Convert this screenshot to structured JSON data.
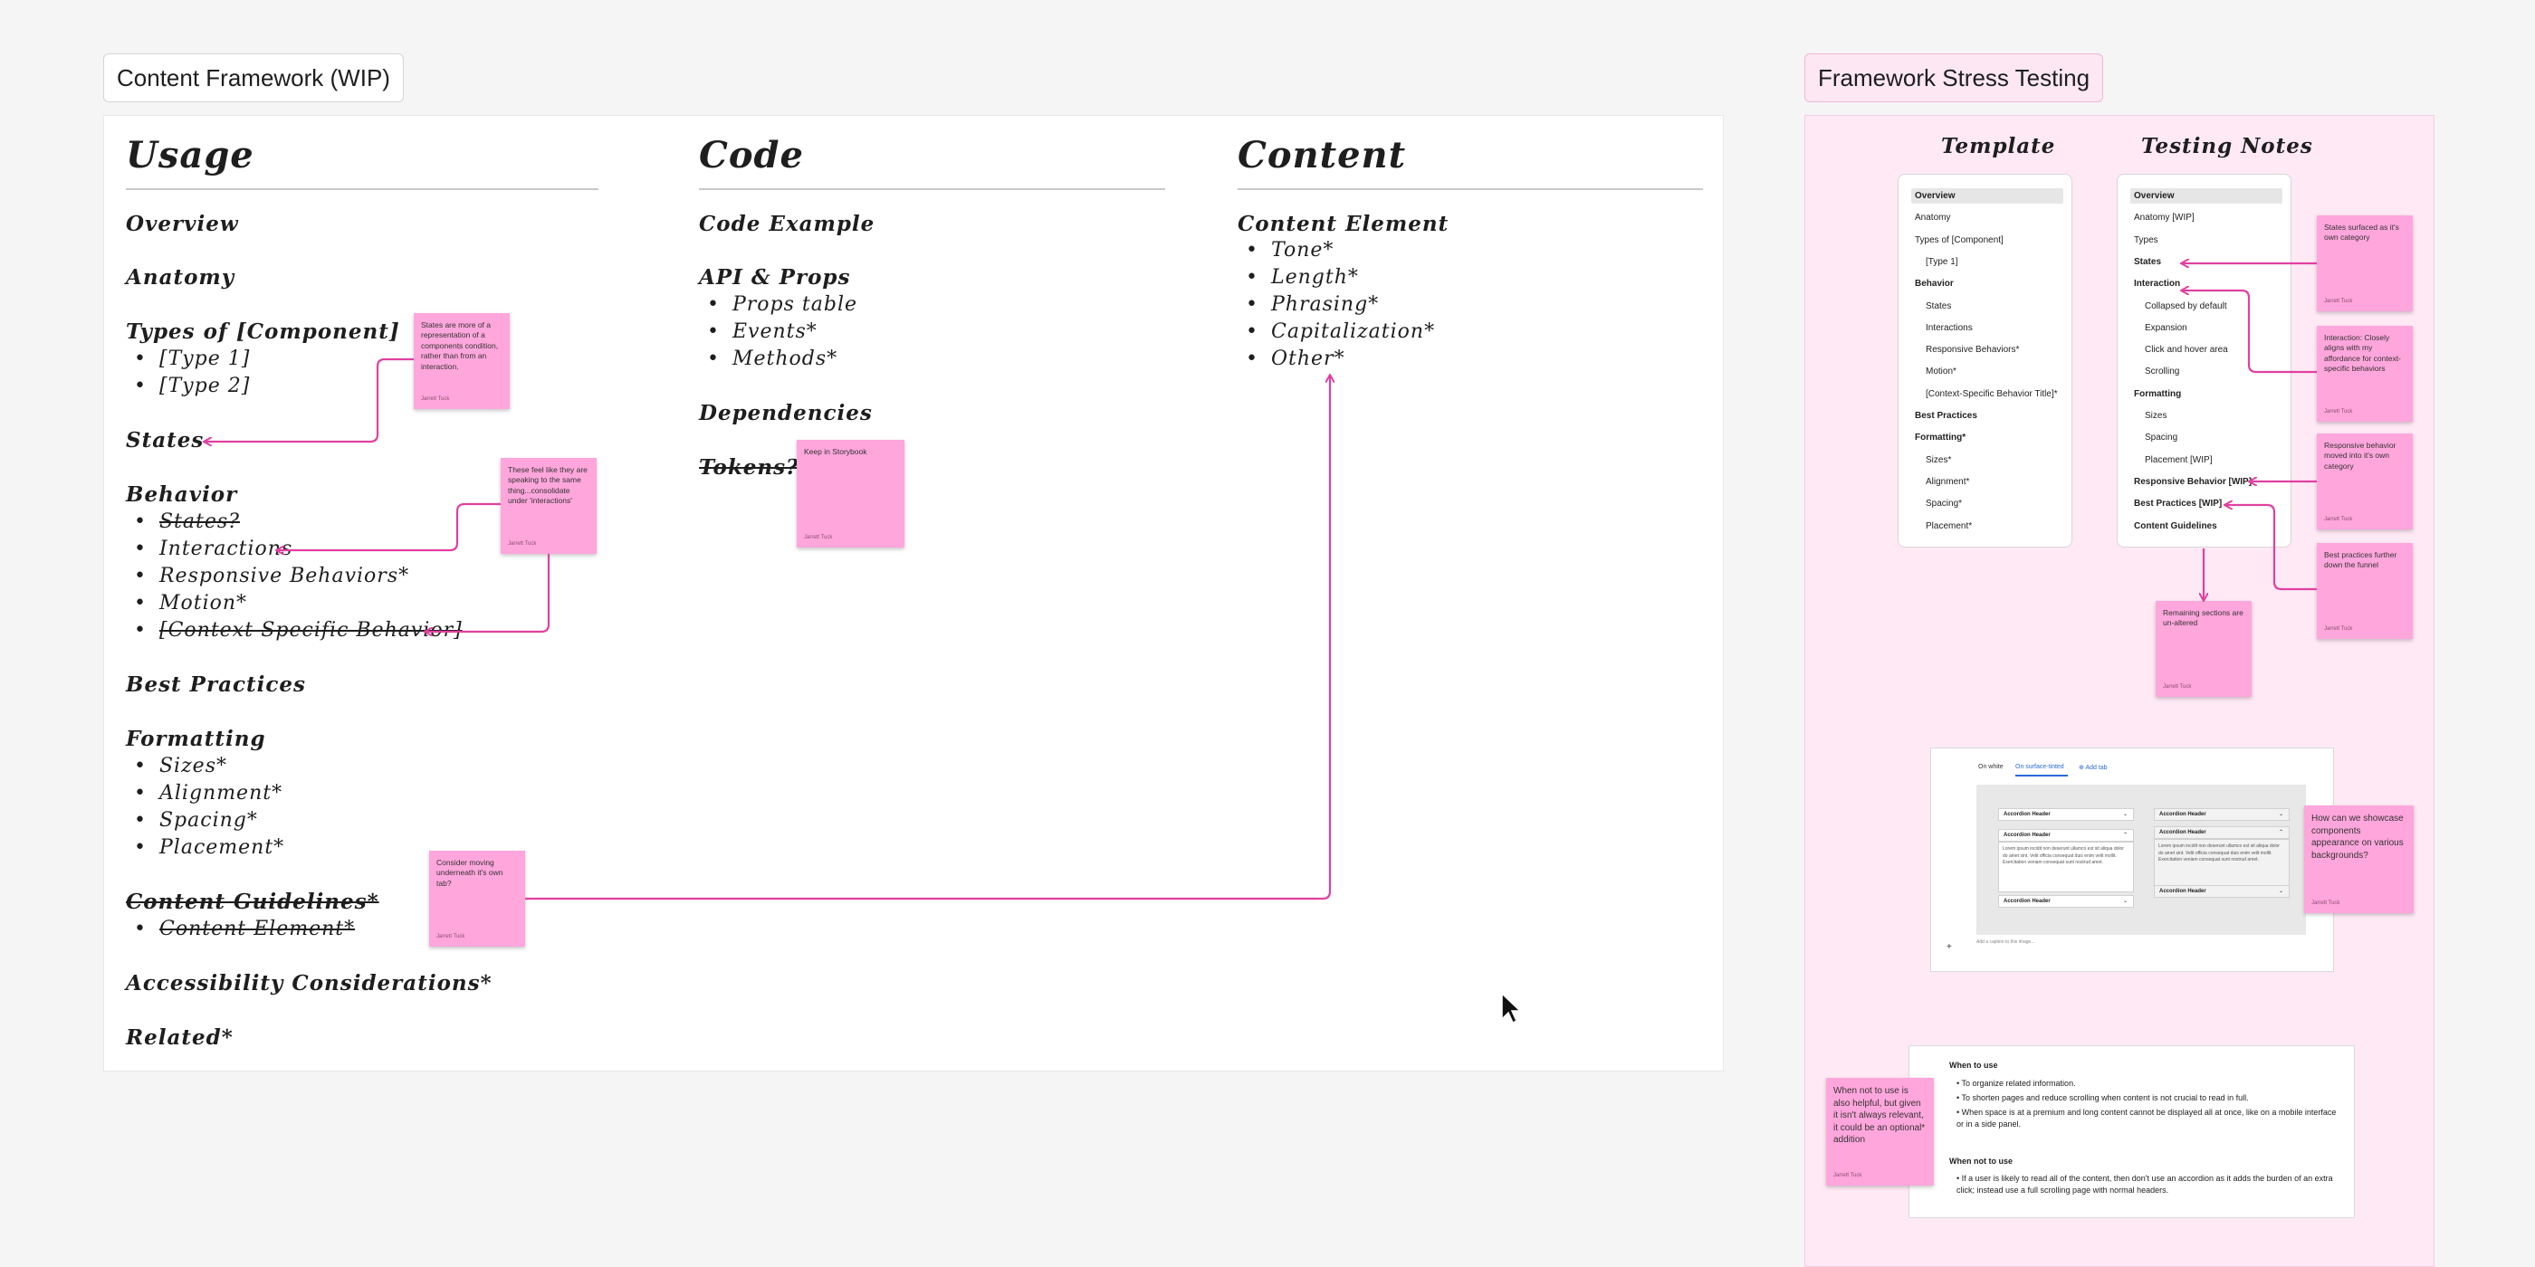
{
  "left_frame": {
    "label": "Content Framework (WIP)",
    "usage": {
      "title": "Usage",
      "items": [
        {
          "heading": "Overview"
        },
        {
          "heading": "Anatomy"
        },
        {
          "heading": "Types of [Component]",
          "bullets": [
            "[Type 1]",
            "[Type 2]"
          ]
        },
        {
          "heading": "States"
        },
        {
          "heading": "Behavior",
          "bullets": [
            "States?",
            "Interactions",
            "Responsive Behaviors*",
            "Motion*",
            "[Context-Specific Behavior]"
          ]
        },
        {
          "heading": "Best Practices"
        },
        {
          "heading": "Formatting",
          "bullets": [
            "Sizes*",
            "Alignment*",
            "Spacing*",
            "Placement*"
          ]
        },
        {
          "heading": "Content Guidelines*",
          "bullets": [
            "Content Element*"
          ]
        },
        {
          "heading": "Accessibility Considerations*"
        },
        {
          "heading": "Related*"
        }
      ]
    },
    "code": {
      "title": "Code",
      "items": [
        {
          "heading": "Code Example"
        },
        {
          "heading": "API & Props",
          "bullets": [
            "Props table",
            "Events*",
            "Methods*"
          ]
        },
        {
          "heading": "Dependencies"
        },
        {
          "heading": "Tokens?"
        }
      ]
    },
    "content": {
      "title": "Content",
      "items": [
        {
          "heading": "Content Element",
          "bullets": [
            "Tone*",
            "Length*",
            "Phrasing*",
            "Capitalization*",
            "Other*"
          ]
        }
      ]
    },
    "stickies": [
      {
        "text": "States are more of a representation of a components condition, rather than from an interaction.",
        "author": "Jarrett Tuck"
      },
      {
        "text": "These feel like they are speaking to the same thing...consolidate under 'interactions'",
        "author": "Jarrett Tuck"
      },
      {
        "text": "Keep in Storybook",
        "author": "Jarrett Tuck"
      },
      {
        "text": "Consider moving underneath it's own tab?",
        "author": "Jarrett Tuck"
      }
    ]
  },
  "right_frame": {
    "label": "Framework Stress Testing",
    "template": {
      "title": "Template",
      "items": [
        {
          "text": "Overview",
          "bold": true,
          "selected": true,
          "indent": false
        },
        {
          "text": "Anatomy",
          "bold": false,
          "indent": false
        },
        {
          "text": "Types of [Component]",
          "bold": false,
          "indent": false
        },
        {
          "text": "[Type 1]",
          "bold": false,
          "indent": true
        },
        {
          "text": "Behavior",
          "bold": true,
          "indent": false
        },
        {
          "text": "States",
          "bold": false,
          "indent": true
        },
        {
          "text": "Interactions",
          "bold": false,
          "indent": true
        },
        {
          "text": "Responsive Behaviors*",
          "bold": false,
          "indent": true
        },
        {
          "text": "Motion*",
          "bold": false,
          "indent": true
        },
        {
          "text": "[Context-Specific Behavior Title]*",
          "bold": false,
          "indent": true
        },
        {
          "text": "Best Practices",
          "bold": true,
          "indent": false
        },
        {
          "text": "Formatting*",
          "bold": true,
          "indent": false
        },
        {
          "text": "Sizes*",
          "bold": false,
          "indent": true
        },
        {
          "text": "Alignment*",
          "bold": false,
          "indent": true
        },
        {
          "text": "Spacing*",
          "bold": false,
          "indent": true
        },
        {
          "text": "Placement*",
          "bold": false,
          "indent": true
        }
      ]
    },
    "testing_notes": {
      "title": "Testing Notes",
      "items": [
        {
          "text": "Overview",
          "bold": true,
          "selected": true,
          "indent": false
        },
        {
          "text": "Anatomy [WIP]",
          "bold": false,
          "indent": false
        },
        {
          "text": "Types",
          "bold": false,
          "indent": false
        },
        {
          "text": "States",
          "bold": true,
          "indent": false
        },
        {
          "text": "Interaction",
          "bold": true,
          "indent": false
        },
        {
          "text": "Collapsed by default",
          "bold": false,
          "indent": true
        },
        {
          "text": "Expansion",
          "bold": false,
          "indent": true
        },
        {
          "text": "Click and hover area",
          "bold": false,
          "indent": true
        },
        {
          "text": "Scrolling",
          "bold": false,
          "indent": true
        },
        {
          "text": "Formatting",
          "bold": true,
          "indent": false
        },
        {
          "text": "Sizes",
          "bold": false,
          "indent": true
        },
        {
          "text": "Spacing",
          "bold": false,
          "indent": true
        },
        {
          "text": "Placement [WIP]",
          "bold": false,
          "indent": true
        },
        {
          "text": "Responsive Behavior [WIP]",
          "bold": true,
          "indent": false
        },
        {
          "text": "Best Practices [WIP]",
          "bold": true,
          "indent": false
        },
        {
          "text": "Content Guidelines",
          "bold": true,
          "indent": false
        }
      ]
    },
    "stickies": [
      {
        "text": "States surfaced as it's own category",
        "author": "Jarrett Tuck"
      },
      {
        "text": "Interaction: Closely aligns with my affordance for context-specific behaviors",
        "author": "Jarrett Tuck"
      },
      {
        "text": "Responsive behavior moved into it's own category",
        "author": "Jarrett Tuck"
      },
      {
        "text": "Best practices further down the funnel",
        "author": "Jarrett Tuck"
      },
      {
        "text": "Remaining sections are un-altered",
        "author": "Jarrett Tuck"
      },
      {
        "text": "How can we showcase components appearance on various backgrounds?",
        "author": "Jarrett Tuck"
      },
      {
        "text": "When not to use is also helpful, but given it isn't always relevant, it could be an optional* addition",
        "author": "Jarrett Tuck"
      }
    ],
    "preview": {
      "tabs": [
        "On white",
        "On surface-tinted",
        "Add tab"
      ],
      "accordion_header": "Accordion Header",
      "lorem": "Lorem ipsum incidit non deserunt ullamco est sit aliqua dolor do amet sint. Velit officia consequat duis enim velit mollit. Exercitation veniam consequat sunt nostrud amet.",
      "caption": "Add a caption to this image..."
    },
    "usage_doc": {
      "when_to_use_title": "When to use",
      "when_to_use": [
        "To organize related information.",
        "To shorten pages and reduce scrolling when content is not crucial to read in full.",
        "When space is at a premium and long content cannot be displayed all at once, like on a mobile interface or in a side panel."
      ],
      "when_not_title": "When not to use",
      "when_not": [
        "If a user is likely to read all of the content, then don't use an accordion as it adds the burden of an extra click; instead use a full scrolling page with normal headers."
      ]
    }
  },
  "colors": {
    "sticky": "#ffa6dd",
    "connector": "#e040a0",
    "pink_frame": "#ffe9f5"
  }
}
